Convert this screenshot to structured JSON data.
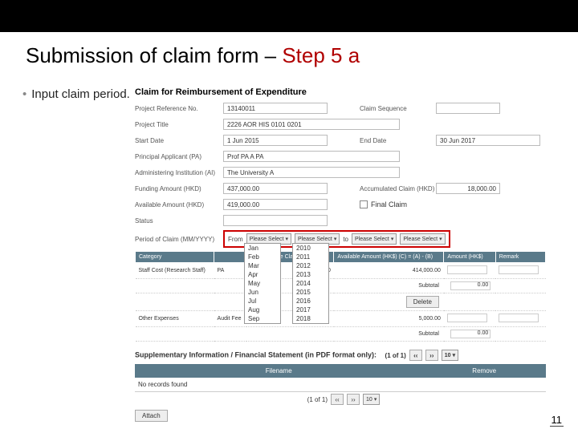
{
  "slide": {
    "title_black": "Submission of claim form – ",
    "title_red": "Step 5 a",
    "bullet": "Input claim period.",
    "page_number": "11"
  },
  "form": {
    "title": "Claim for Reimbursement of Expenditure",
    "labels": {
      "project_ref": "Project Reference No.",
      "claim_seq": "Claim Sequence",
      "project_title": "Project Title",
      "start_date": "Start Date",
      "end_date": "End Date",
      "pa": "Principal Applicant (PA)",
      "ai": "Administering Institution (AI)",
      "funding_amt": "Funding Amount (HKD)",
      "accum_claim": "Accumulated Claim (HKD)",
      "avail_amt": "Available Amount (HKD)",
      "final_claim": "Final Claim",
      "status": "Status",
      "poc": "Period of Claim (MM/YYYY)",
      "from": "From",
      "to": "to"
    },
    "values": {
      "project_ref": "13140011",
      "claim_seq": "",
      "project_title": "2226 AOR  HIS 0101 0201",
      "start_date": "1 Jun 2015",
      "end_date": "30 Jun 2017",
      "pa": "Prof PA A PA",
      "ai": "The University A",
      "funding_amt": "437,000.00",
      "accum_claim": "18,000.00",
      "avail_amt": "419,000.00",
      "status": "",
      "sel_placeholder": "Please Select"
    },
    "month_options": [
      "Jan",
      "Feb",
      "Mar",
      "Apr",
      "May",
      "Jun",
      "Jul",
      "Aug",
      "Sep"
    ],
    "year_options": [
      "2010",
      "2011",
      "2012",
      "2013",
      "2014",
      "2015",
      "2016",
      "2017",
      "2018"
    ],
    "table": {
      "headers": {
        "category": "Category",
        "approver": "",
        "accum": "Accumulative Claim (HK$) (B)",
        "avail": "Available Amount (HK$) (C) = (A) - (B)",
        "amount": "Amount (HK$)",
        "remark": "Remark"
      },
      "rows": [
        {
          "cat": "Staff Cost (Research Staff)",
          "app": "PA",
          "accum": "18,000.00",
          "avail": "414,000.00"
        }
      ],
      "subtotal_label": "Subtotal",
      "subtotal_value": "0.00",
      "delete_label": "Delete",
      "other_row": {
        "cat": "Other Expenses",
        "app": "Audit Fee",
        "avail": "5,000.00"
      },
      "subtotal2_label": "Subtotal",
      "subtotal2_value": "0.00"
    },
    "supp": {
      "title": "Supplementary Information / Financial Statement (in PDF format only):",
      "pager_text": "(1 of 1)",
      "pager_size": "10",
      "filename_hdr": "Filename",
      "remove_hdr": "Remove",
      "no_records": "No records found",
      "attach": "Attach"
    }
  }
}
